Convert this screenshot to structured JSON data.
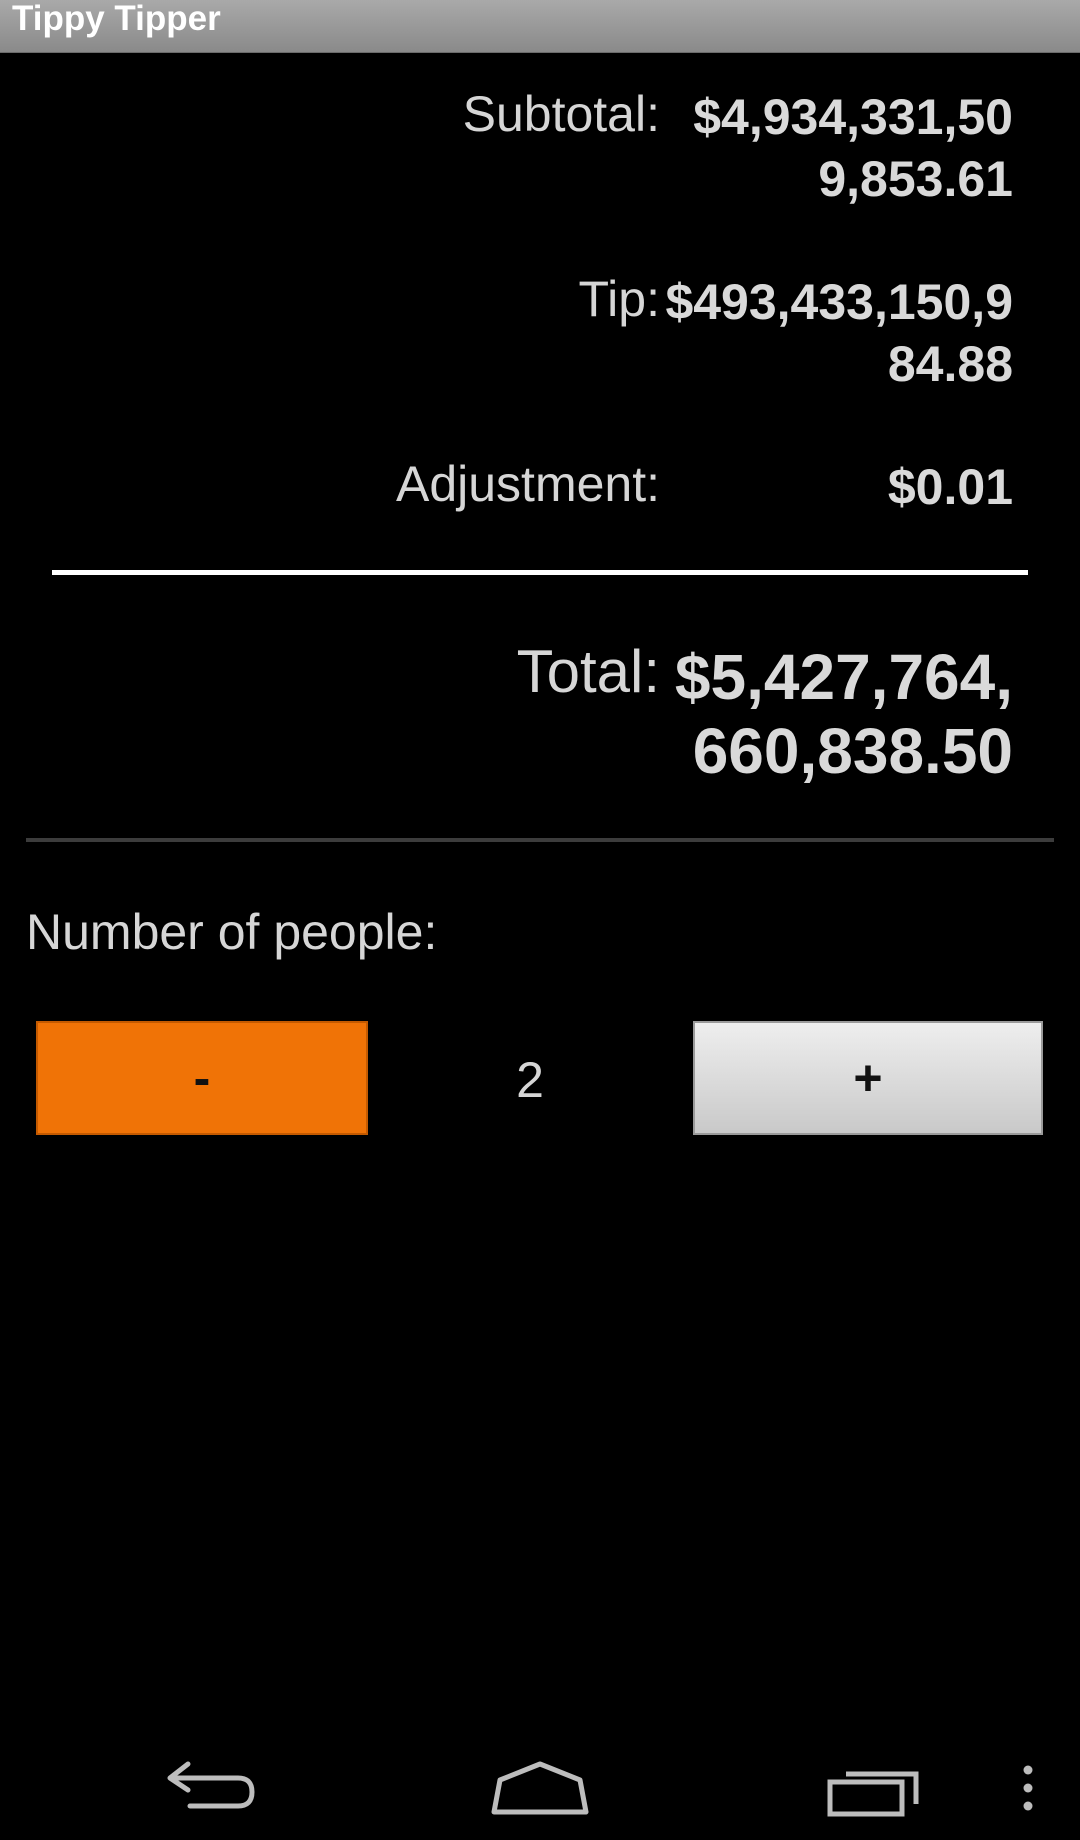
{
  "app": {
    "title": "Tippy Tipper"
  },
  "summary": {
    "subtotal_label": "Subtotal:",
    "subtotal_value": "$4,934,331,509,853.61",
    "tip_label": "Tip:",
    "tip_value": "$493,433,150,984.88",
    "adjustment_label": "Adjustment:",
    "adjustment_value": "$0.01",
    "total_label": "Total:",
    "total_value": "$5,427,764,660,838.50"
  },
  "people": {
    "label": "Number of people:",
    "count": "2",
    "minus_label": "-",
    "plus_label": "+"
  },
  "colors": {
    "minus_button": "#f07306",
    "plus_button": "#d9d9d9",
    "background": "#000000",
    "title_bar": "#9a9a9a"
  },
  "nav": {
    "icons": [
      "back-icon",
      "home-icon",
      "recent-apps-icon",
      "overflow-menu-icon"
    ]
  }
}
